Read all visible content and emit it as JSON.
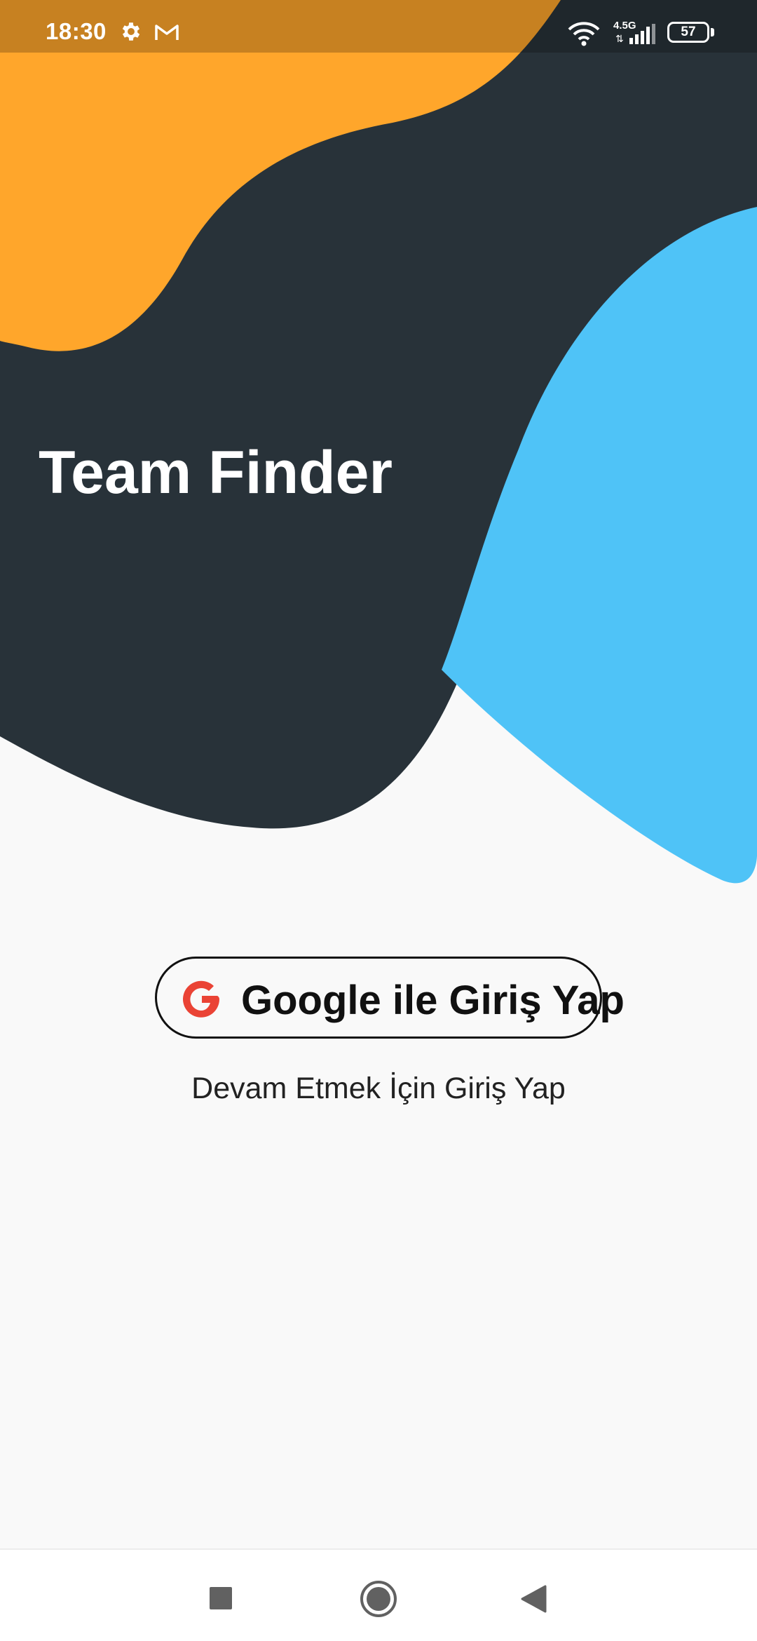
{
  "status_bar": {
    "time": "18:30",
    "network_type": "4.5G",
    "battery_level": "57",
    "icons": [
      "gear-icon",
      "gmail-icon",
      "wifi-icon",
      "signal-icon",
      "battery-icon"
    ]
  },
  "app": {
    "title": "Team Finder"
  },
  "login": {
    "google_button_label": "Google ile Giriş Yap",
    "subtitle": "Devam Etmek İçin Giriş Yap"
  },
  "nav_bar": {
    "icons": [
      "recents-square-icon",
      "home-circle-icon",
      "back-triangle-icon"
    ]
  },
  "colors": {
    "background": "#f9f9f9",
    "dark_shape": "#283239",
    "orange_shape": "#ffa62b",
    "blue_shape": "#4fc3f7",
    "google_red": "#ea4335"
  }
}
